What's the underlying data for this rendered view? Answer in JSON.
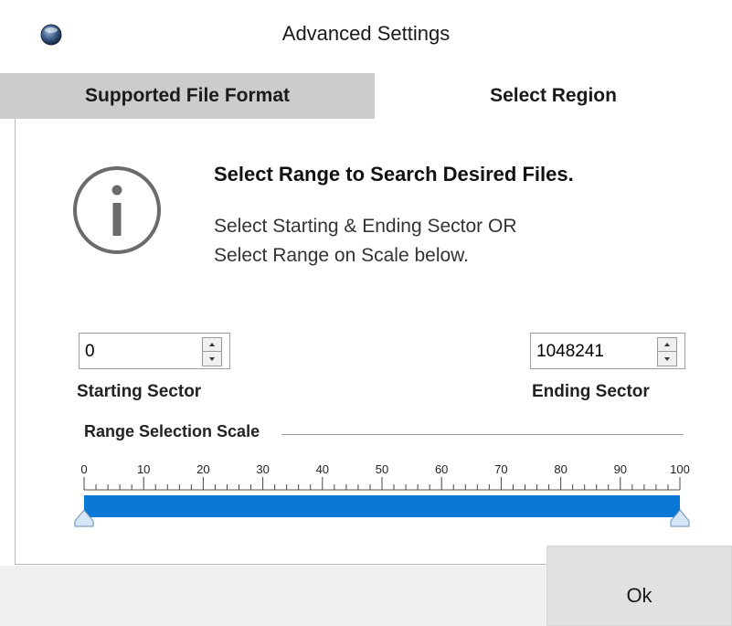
{
  "window": {
    "title": "Advanced Settings"
  },
  "tabs": [
    {
      "label": "Supported File Format",
      "active": false
    },
    {
      "label": "Select Region",
      "active": true
    }
  ],
  "message": {
    "title": "Select Range to Search Desired Files.",
    "line1": "Select Starting & Ending Sector OR",
    "line2": "Select Range on Scale below."
  },
  "starting_sector": {
    "value": "0",
    "label": "Starting Sector"
  },
  "ending_sector": {
    "value": "1048241",
    "label": "Ending Sector"
  },
  "scale": {
    "caption": "Range Selection Scale",
    "tick_labels": [
      "0",
      "10",
      "20",
      "30",
      "40",
      "50",
      "60",
      "70",
      "80",
      "90",
      "100"
    ],
    "range_start": 0,
    "range_end": 100,
    "fill_color": "#0a78d7"
  },
  "footer": {
    "ok_label": "Ok"
  }
}
